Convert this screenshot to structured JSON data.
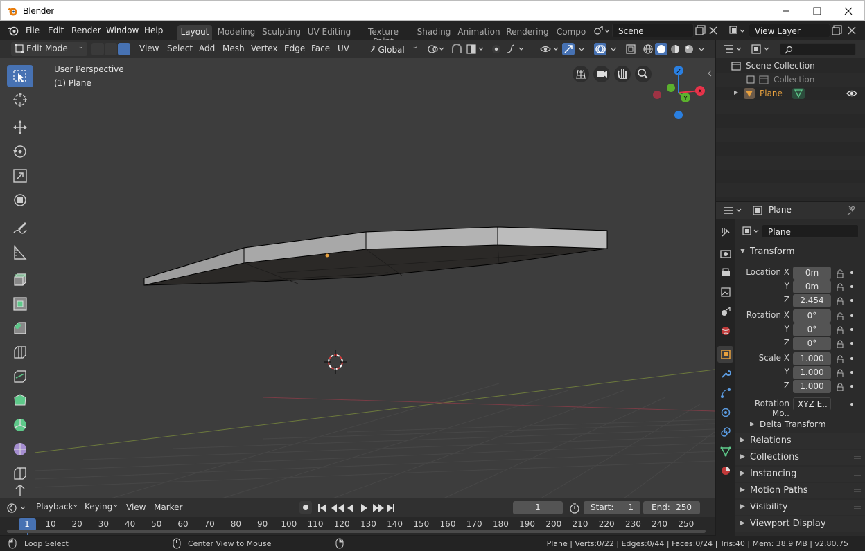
{
  "window": {
    "title": "Blender",
    "controls": [
      "minimize-icon",
      "maximize-icon",
      "close-icon"
    ]
  },
  "menus": [
    "File",
    "Edit",
    "Render",
    "Window",
    "Help"
  ],
  "workspaces": [
    "Layout",
    "Modeling",
    "Sculpting",
    "UV Editing",
    "Texture Paint",
    "Shading",
    "Animation",
    "Rendering",
    "Compo"
  ],
  "active_workspace": "Layout",
  "scene": {
    "name": "Scene"
  },
  "view_layer": {
    "name": "View Layer"
  },
  "viewport_header": {
    "mode": "Edit Mode",
    "menus": [
      "View",
      "Select",
      "Add",
      "Mesh",
      "Vertex",
      "Edge",
      "Face",
      "UV"
    ],
    "orientation": "Global"
  },
  "viewport": {
    "view_name": "User Perspective",
    "object_info": "(1) Plane",
    "gizmo_axes": {
      "z": "Z",
      "y": "Y",
      "x": "X"
    }
  },
  "outliner": {
    "rows": [
      {
        "label": "Scene Collection"
      },
      {
        "label": "Collection"
      },
      {
        "label": "Plane"
      }
    ]
  },
  "properties": {
    "object_name": "Plane",
    "data_name": "Plane",
    "transform": {
      "title": "Transform",
      "location": {
        "label": "Location X",
        "x": "0m",
        "y": "0m",
        "z": "2.454"
      },
      "rotation": {
        "label": "Rotation X",
        "x": "0°",
        "y": "0°",
        "z": "0°"
      },
      "scale": {
        "label": "Scale X",
        "x": "1.000",
        "y": "1.000",
        "z": "1.000"
      },
      "axis_y": "Y",
      "axis_z": "Z",
      "rotation_mode_label": "Rotation Mo..",
      "rotation_mode_value": "XYZ E..",
      "delta": "Delta Transform"
    },
    "panels": [
      "Relations",
      "Collections",
      "Instancing",
      "Motion Paths",
      "Visibility",
      "Viewport Display"
    ]
  },
  "timeline": {
    "menus": [
      "Playback",
      "Keying",
      "View",
      "Marker"
    ],
    "current_frame": "1",
    "start_label": "Start:",
    "start": "1",
    "end_label": "End:",
    "end": "250",
    "ticks": [
      "1",
      "10",
      "20",
      "30",
      "40",
      "50",
      "60",
      "70",
      "80",
      "90",
      "100",
      "110",
      "120",
      "130",
      "140",
      "150",
      "160",
      "170",
      "180",
      "190",
      "200",
      "210",
      "220",
      "230",
      "240",
      "250"
    ]
  },
  "statusbar": {
    "left": "Loop Select",
    "middle": "Center View to Mouse",
    "right": "Plane | Verts:0/22 | Edges:0/44 | Faces:0/24 | Tris:40 | Mem: 38.9 MB | v2.80.75"
  },
  "colors": {
    "accent": "#4772b3",
    "axis_x": "#e8334a",
    "axis_y": "#5bb12d",
    "axis_z": "#2a7fe0",
    "object_orange": "#e8a13e"
  }
}
